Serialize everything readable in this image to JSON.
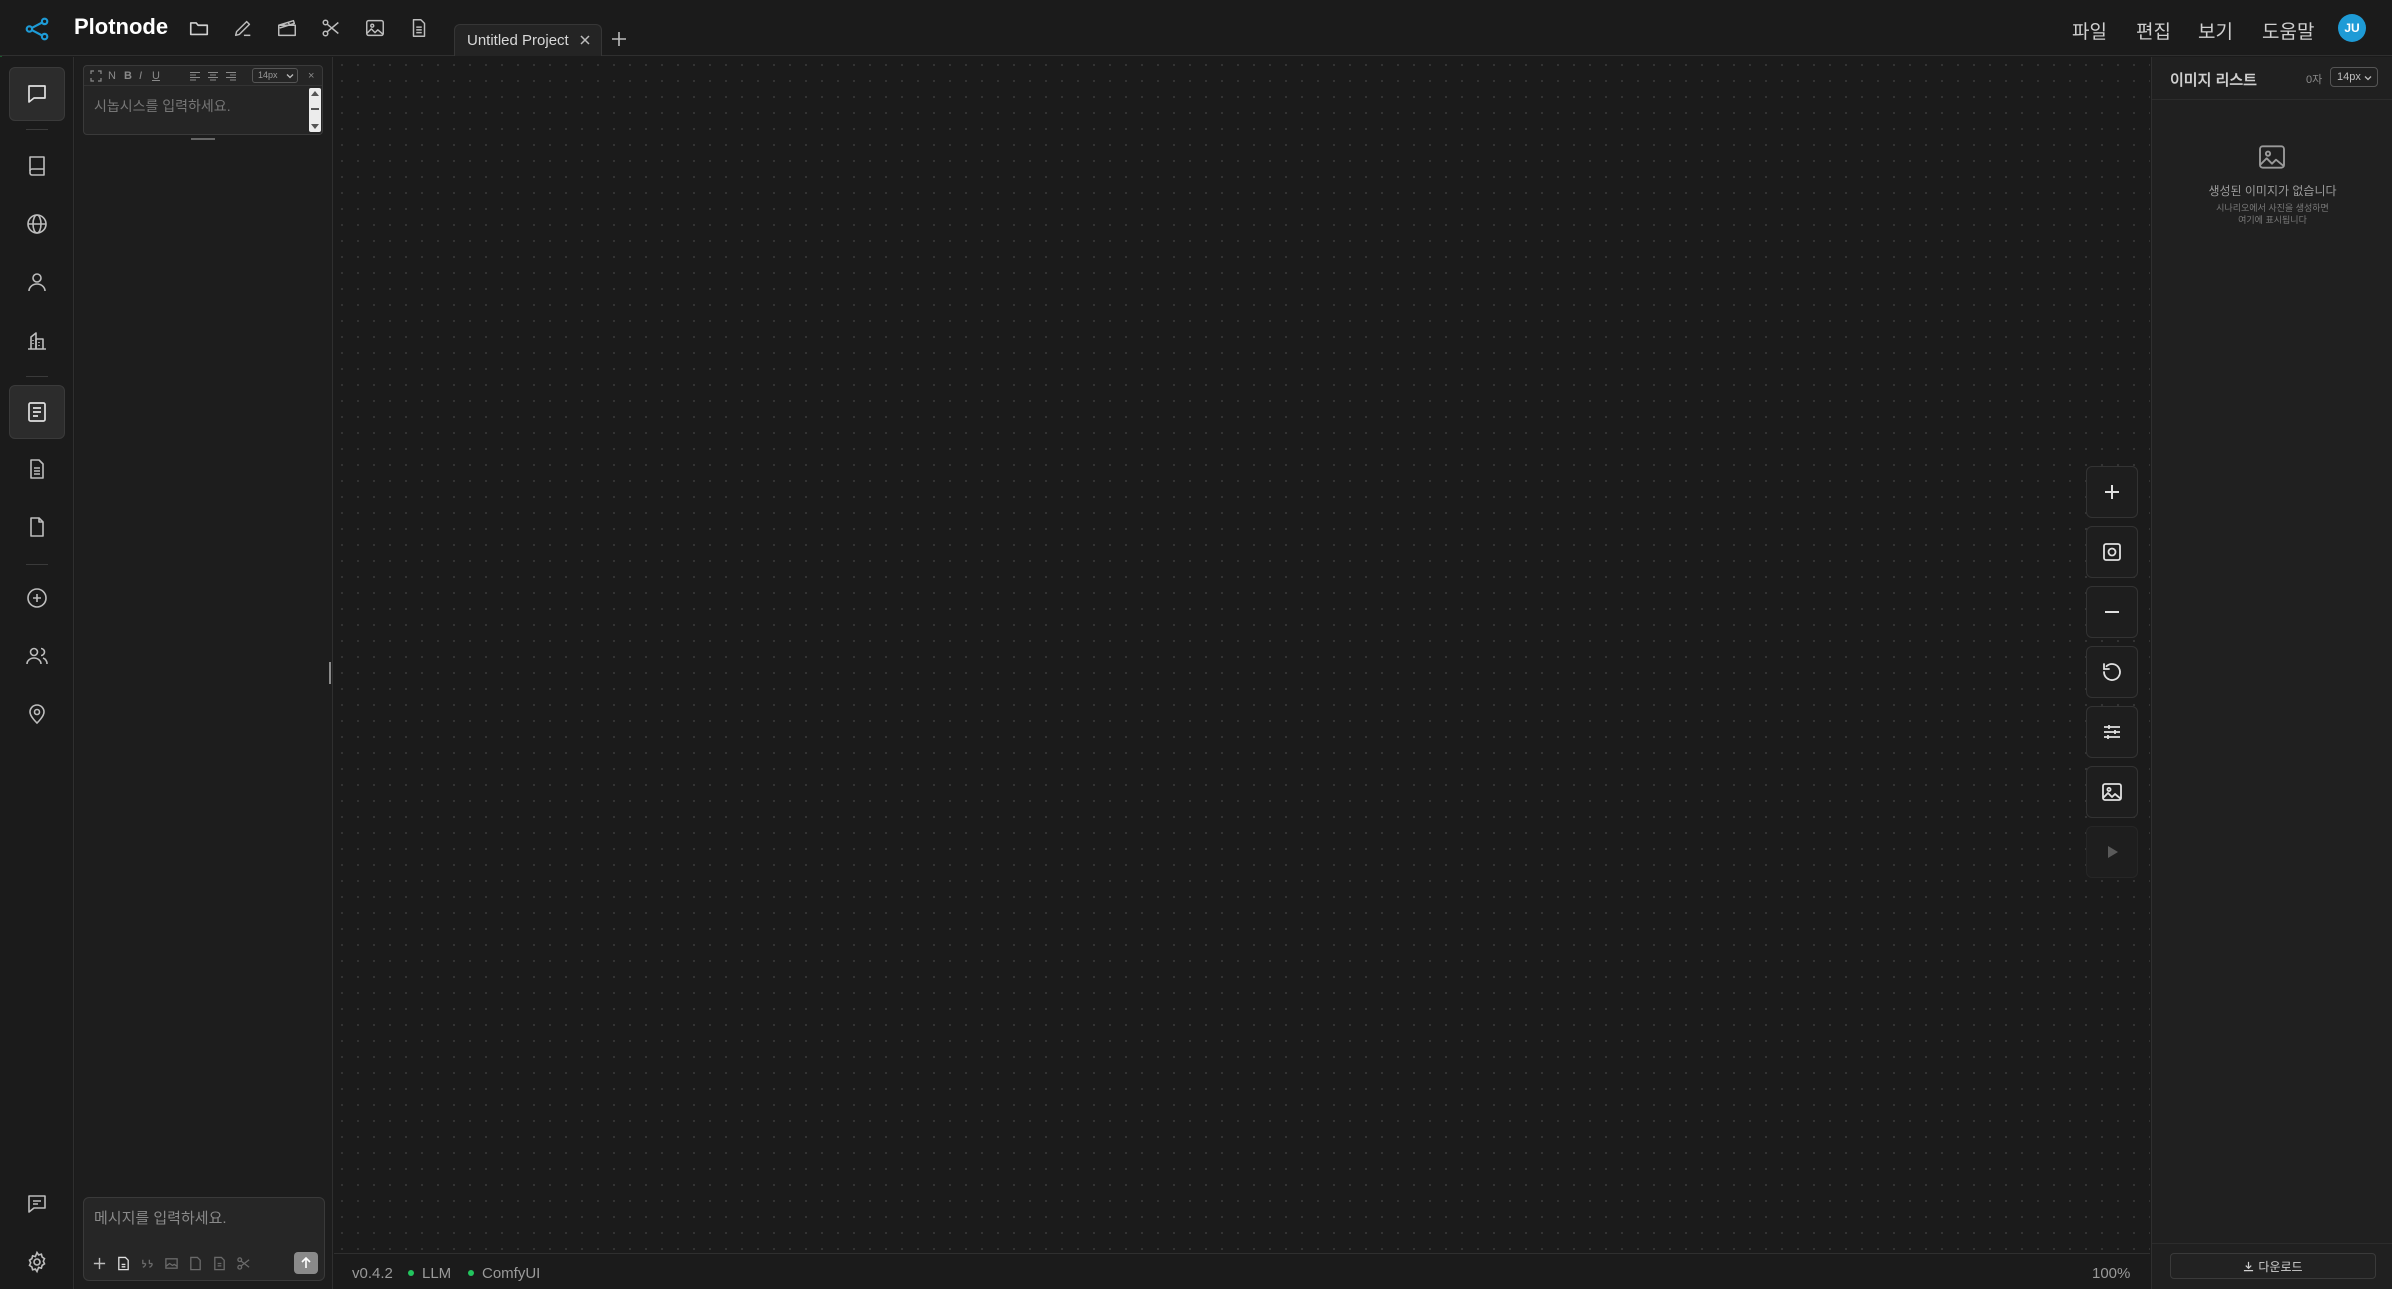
{
  "app": {
    "name": "Plotnode",
    "accent_color": "#1e9bd6"
  },
  "toolbar": {
    "icons": [
      "folder-icon",
      "pencil-icon",
      "clapperboard-icon",
      "scissors-icon",
      "image-icon",
      "document-icon"
    ]
  },
  "tabs": [
    {
      "label": "Untitled Project",
      "active": true
    }
  ],
  "menu": {
    "file": "파일",
    "edit": "편집",
    "view": "보기",
    "help": "도움말"
  },
  "user": {
    "initials": "JU"
  },
  "left_rail": {
    "items": [
      "chat-icon",
      "book-icon",
      "globe-icon",
      "person-icon",
      "buildings-icon",
      "synopsis-icon",
      "script-icon",
      "page-icon",
      "add-circle-icon",
      "people-icon",
      "location-pin-icon",
      "comment-icon",
      "settings-icon"
    ]
  },
  "synopsis_editor": {
    "toolbar": {
      "normal": "N",
      "bold": "B",
      "italic": "I",
      "underline": "U",
      "font_size": "14px",
      "clear": "×"
    },
    "placeholder": "시놉시스를 입력하세요."
  },
  "chat": {
    "placeholder": "메시지를 입력하세요."
  },
  "status": {
    "version": "v0.4.2",
    "llm": "LLM",
    "comfyui": "ComfyUI",
    "zoom": "100%",
    "ok_color": "#22c55e"
  },
  "image_list": {
    "title": "이미지 리스트",
    "count": "0자",
    "font_size": "14px",
    "empty_title": "생성된 이미지가 없습니다",
    "empty_desc_line1": "시나리오에서 사진을 생성하면",
    "empty_desc_line2": "여기에 표시됩니다",
    "download": "다운로드"
  }
}
